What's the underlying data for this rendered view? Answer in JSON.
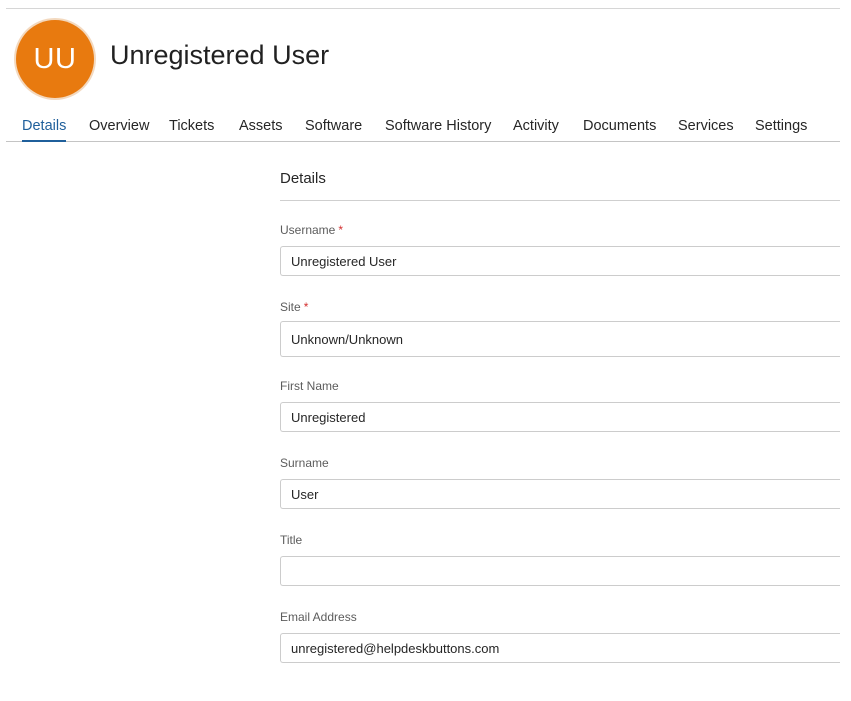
{
  "user": {
    "initials": "UU",
    "name": "Unregistered User"
  },
  "tabs": [
    {
      "label": "Details"
    },
    {
      "label": "Overview"
    },
    {
      "label": "Tickets"
    },
    {
      "label": "Assets"
    },
    {
      "label": "Software"
    },
    {
      "label": "Software History"
    },
    {
      "label": "Activity"
    },
    {
      "label": "Documents"
    },
    {
      "label": "Services"
    },
    {
      "label": "Settings"
    }
  ],
  "active_tab": "Details",
  "section": {
    "title": "Details"
  },
  "fields": {
    "username": {
      "label": "Username",
      "required_mark": "*",
      "value": "Unregistered User"
    },
    "site": {
      "label": "Site",
      "required_mark": "*",
      "value": "Unknown/Unknown"
    },
    "first_name": {
      "label": "First Name",
      "value": "Unregistered"
    },
    "surname": {
      "label": "Surname",
      "value": "User"
    },
    "title": {
      "label": "Title",
      "value": ""
    },
    "email": {
      "label": "Email Address",
      "value": "unregistered@helpdeskbuttons.com"
    }
  },
  "colors": {
    "avatar": "#e87a0f",
    "active_tab": "#1f5f9b",
    "required": "#d32f2f"
  }
}
